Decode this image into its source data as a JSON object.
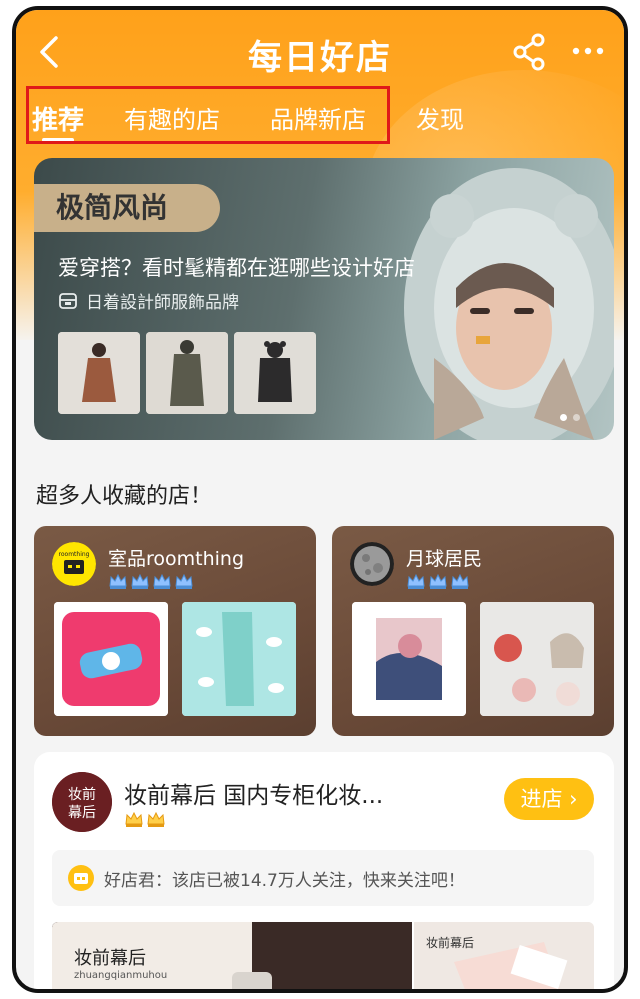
{
  "header": {
    "logo_text": "每日好店"
  },
  "tabs": [
    {
      "label": "推荐"
    },
    {
      "label": "有趣的店"
    },
    {
      "label": "品牌新店"
    },
    {
      "label": "发现"
    }
  ],
  "banner": {
    "tag": "极简风尚",
    "title": "爱穿搭？看时髦精都在逛哪些设计好店",
    "subtitle": "日着設計師服飾品牌"
  },
  "section": {
    "title": "超多人收藏的店！"
  },
  "stores": [
    {
      "name": "室品roomthing",
      "logo_text": "roomthing",
      "crown_count": 4
    },
    {
      "name": "月球居民",
      "crown_count": 3
    }
  ],
  "featured_store": {
    "logo_text_1": "妆前",
    "logo_text_2": "幕后",
    "name": "妆前幕后 国内专柜化妆...",
    "crown_count": 2,
    "enter_label": "进店",
    "notice": "好店君：该店已被14.7万人关注，快来关注吧！",
    "image_caption": "妆前幕后",
    "image_caption_pinyin": "zhuangqianmuhou",
    "image_caption_right": "妆前幕后"
  },
  "colors": {
    "brand_orange": "#ffa11a",
    "highlight_red": "#e01919",
    "enter_yellow": "#ffc012"
  }
}
